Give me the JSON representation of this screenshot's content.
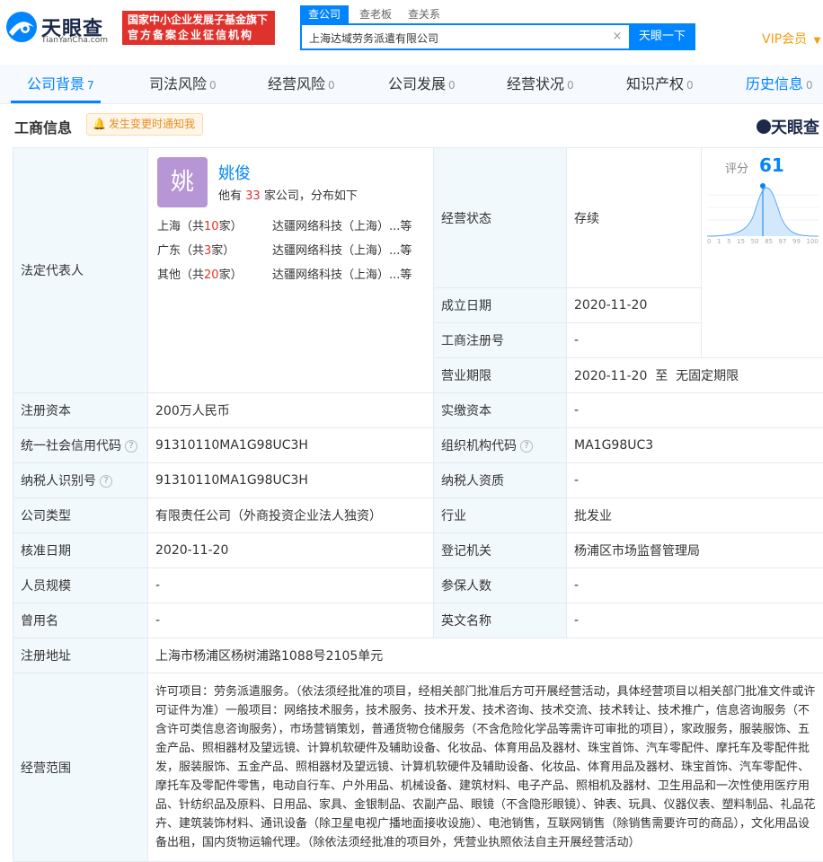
{
  "header": {
    "logo_text": "天眼查",
    "logo_sub": "TianYanCha.com",
    "badge_line1": "国家中小企业发展子基金旗下",
    "badge_line2": "官方备案企业征信机构",
    "search_tabs": [
      "查公司",
      "查老板",
      "查关系"
    ],
    "search_value": "上海达域劳务派遣有限公司",
    "search_button": "天眼一下",
    "vip_label": "VIP会员"
  },
  "nav": [
    {
      "label": "公司背景",
      "count": "7"
    },
    {
      "label": "司法风险",
      "count": "0"
    },
    {
      "label": "经营风险",
      "count": "0"
    },
    {
      "label": "公司发展",
      "count": "0"
    },
    {
      "label": "经营状况",
      "count": "0"
    },
    {
      "label": "知识产权",
      "count": "0"
    },
    {
      "label": "历史信息",
      "count": "0"
    }
  ],
  "section": {
    "title": "工商信息",
    "notify_label": "发生变更时通知我",
    "brand": "天眼查"
  },
  "representative": {
    "label": "法定代表人",
    "avatar_char": "姚",
    "name": "姚俊",
    "desc_prefix": "他有",
    "desc_count": "33",
    "desc_suffix": "家公司，分布如下",
    "regions": [
      {
        "region": "上海（共",
        "count": "10",
        "unit": "家）",
        "company": "达疆网络科技（上海）...等"
      },
      {
        "region": "广东（共",
        "count": "3",
        "unit": "家）",
        "company": "达疆网络科技（上海）...等"
      },
      {
        "region": "其他（共",
        "count": "20",
        "unit": "家）",
        "company": "达疆网络科技（上海）...等"
      }
    ]
  },
  "right_top": {
    "rows": [
      {
        "label": "经营状态",
        "value": "存续"
      },
      {
        "label": "成立日期",
        "value": "2020-11-20"
      },
      {
        "label": "工商注册号",
        "value": "-"
      },
      {
        "label": "营业期限",
        "value": "2020-11-20  至  无固定期限"
      }
    ],
    "score_label": "评分",
    "score_value": "61",
    "score_ticks": [
      "0",
      "1",
      "5",
      "15",
      "50",
      "85",
      "97",
      "99",
      "100"
    ]
  },
  "rows": [
    {
      "l1": "注册资本",
      "v1": "200万人民币",
      "l2": "实缴资本",
      "v2": "-"
    },
    {
      "l1": "统一社会信用代码",
      "v1": "91310110MA1G98UC3H",
      "l2": "组织机构代码",
      "v2": "MA1G98UC3"
    },
    {
      "l1": "纳税人识别号",
      "v1": "91310110MA1G98UC3H",
      "l2": "纳税人资质",
      "v2": "-"
    },
    {
      "l1": "公司类型",
      "v1": "有限责任公司（外商投资企业法人独资）",
      "l2": "行业",
      "v2": "批发业"
    },
    {
      "l1": "核准日期",
      "v1": "2020-11-20",
      "l2": "登记机关",
      "v2": "杨浦区市场监督管理局"
    },
    {
      "l1": "人员规模",
      "v1": "-",
      "l2": "参保人数",
      "v2": "-"
    },
    {
      "l1": "曾用名",
      "v1": "-",
      "l2": "英文名称",
      "v2": "-"
    }
  ],
  "address": {
    "label": "注册地址",
    "value": "上海市杨浦区杨树浦路1088号2105单元"
  },
  "scope": {
    "label": "经营范围",
    "value": "许可项目：劳务派遣服务。（依法须经批准的项目，经相关部门批准后方可开展经营活动，具体经营项目以相关部门批准文件或许可证件为准）一般项目：网络技术服务，技术服务、技术开发、技术咨询、技术交流、技术转让、技术推广，信息咨询服务（不含许可类信息咨询服务），市场营销策划，普通货物仓储服务（不含危险化学品等需许可审批的项目），家政服务，服装服饰、五金产品、照相器材及望远镜、计算机软硬件及辅助设备、化妆品、体育用品及器材、珠宝首饰、汽车零配件、摩托车及零配件批发，服装服饰、五金产品、照相器材及望远镜、计算机软硬件及辅助设备、化妆品、体育用品及器材、珠宝首饰、汽车零配件、摩托车及零配件零售，电动自行车、户外用品、机械设备、建筑材料、电子产品、照相机及器材、卫生用品和一次性使用医疗用品、针纺织品及原料、日用品、家具、金银制品、农副产品、眼镜（不含隐形眼镜）、钟表、玩具、仪器仪表、塑料制品、礼品花卉、建筑装饰材料、通讯设备（除卫星电视广播地面接收设施）、电池销售，互联网销售（除销售需要许可的商品），文化用品设备出租，国内货物运输代理。（除依法须经批准的项目外，凭营业执照依法自主开展经营活动）"
  },
  "colors": {
    "accent": "#0084ff",
    "badge": "#e0322d",
    "label_bg": "#f2f9fc",
    "vip": "#f39c12"
  }
}
